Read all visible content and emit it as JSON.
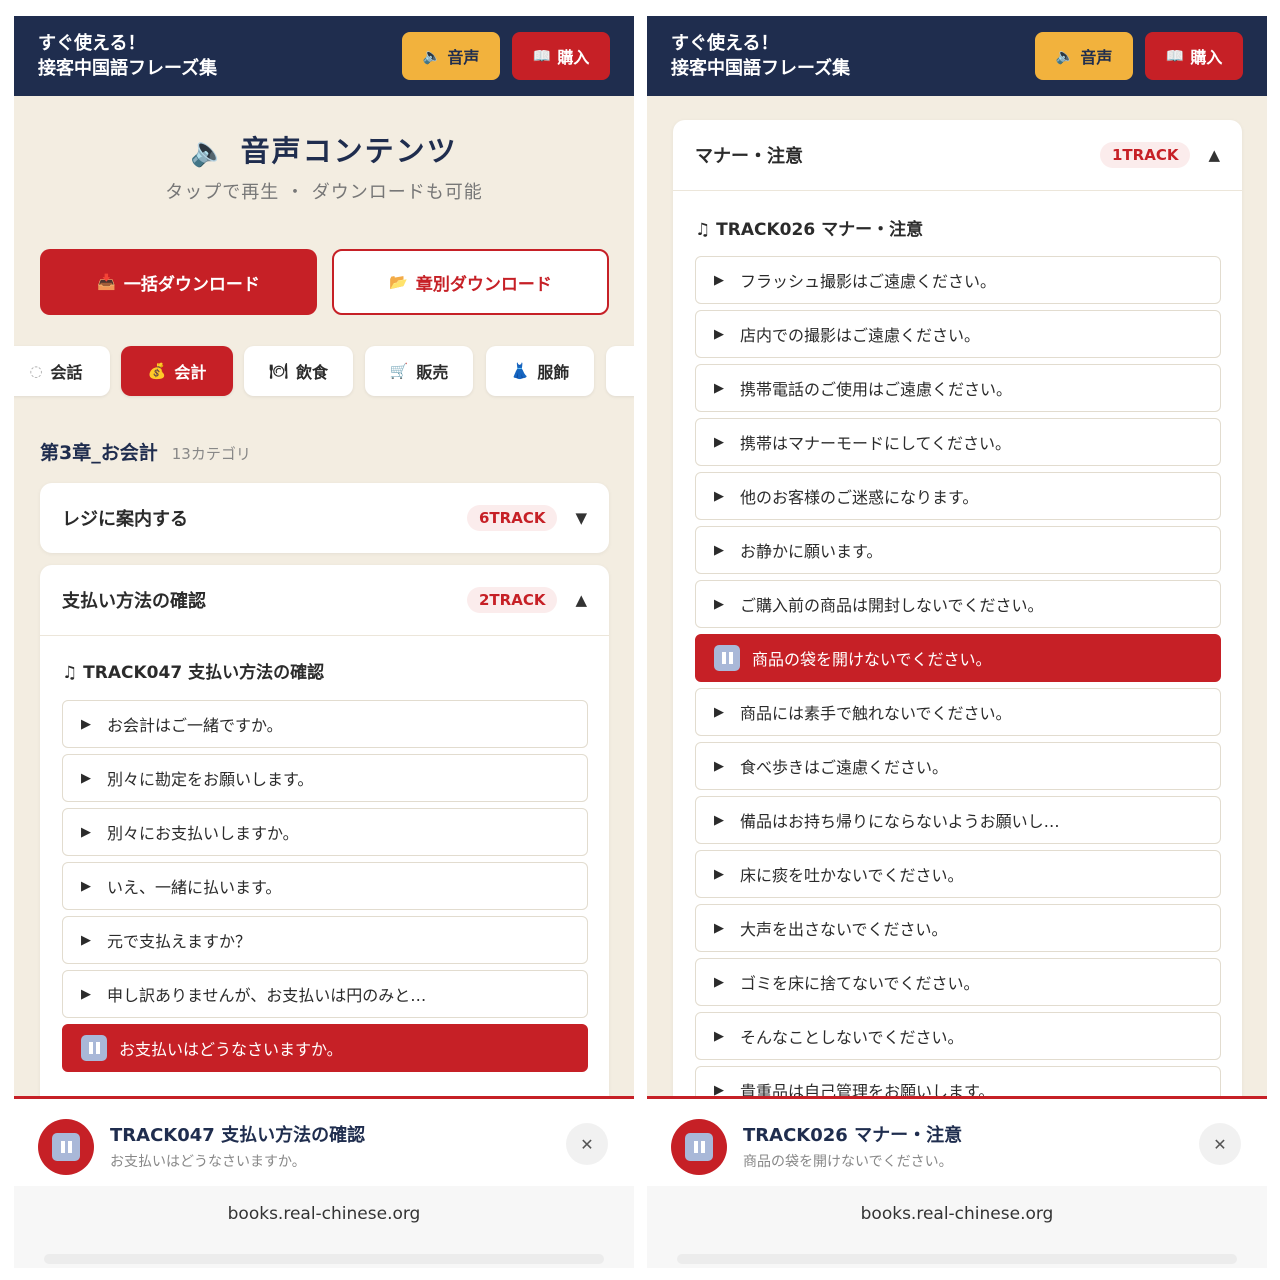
{
  "app": {
    "brand_line1": "すぐ使える！",
    "brand_line2": "接客中国語フレーズ集",
    "audio_label": "音声",
    "buy_label": "購入",
    "accent": "#c62026",
    "navy": "#1f2d4e"
  },
  "left": {
    "section_title": "音声コンテンツ",
    "section_subtitle": "タップで再生 ・ ダウンロードも可能",
    "download_all": "一括ダウンロード",
    "download_chapter": "章別ダウンロード",
    "chips": [
      {
        "icon": "conversation-icon",
        "label": "会話"
      },
      {
        "icon": "money-bag-icon",
        "label": "会計",
        "active": true
      },
      {
        "icon": "dining-icon",
        "label": "飲食"
      },
      {
        "icon": "cart-icon",
        "label": "販売"
      },
      {
        "icon": "dress-icon",
        "label": "服飾"
      }
    ],
    "chapter_title": "第3章_お会計",
    "chapter_count": "13カテゴリ",
    "accordions": [
      {
        "name": "レジに案内する",
        "badge": "6TRACK",
        "expanded": false
      },
      {
        "name": "支払い方法の確認",
        "badge": "2TRACK",
        "expanded": true
      }
    ],
    "track_title": "TRACK047 支払い方法の確認",
    "phrases": [
      "お会計はご一緒ですか。",
      "別々に勘定をお願いします。",
      "別々にお支払いしますか。",
      "いえ、一緒に払います。",
      "元で支払えますか？",
      "申し訳ありませんが、お支払いは円のみと…",
      "お支払いはどうなさいますか。"
    ],
    "playing_index": 6,
    "player_title": "TRACK047 支払い方法の確認",
    "player_sub": "お支払いはどうなさいますか。",
    "url": "books.real-chinese.org"
  },
  "right": {
    "accordion": {
      "name": "マナー・注意",
      "badge": "1TRACK",
      "expanded": true
    },
    "track_title": "TRACK026 マナー・注意",
    "phrases": [
      "フラッシュ撮影はご遠慮ください。",
      "店内での撮影はご遠慮ください。",
      "携帯電話のご使用はご遠慮ください。",
      "携帯はマナーモードにしてください。",
      "他のお客様のご迷惑になります。",
      "お静かに願います。",
      "ご購入前の商品は開封しないでください。",
      "商品の袋を開けないでください。",
      "商品には素手で触れないでください。",
      "食べ歩きはご遠慮ください。",
      "備品はお持ち帰りにならないようお願いし…",
      "床に痰を吐かないでください。",
      "大声を出さないでください。",
      "ゴミを床に捨てないでください。",
      "そんなことしないでください。",
      "貴重品は自己管理をお願いします。"
    ],
    "playing_index": 7,
    "player_title": "TRACK026 マナー・注意",
    "player_sub": "商品の袋を開けないでください。",
    "url": "books.real-chinese.org"
  }
}
